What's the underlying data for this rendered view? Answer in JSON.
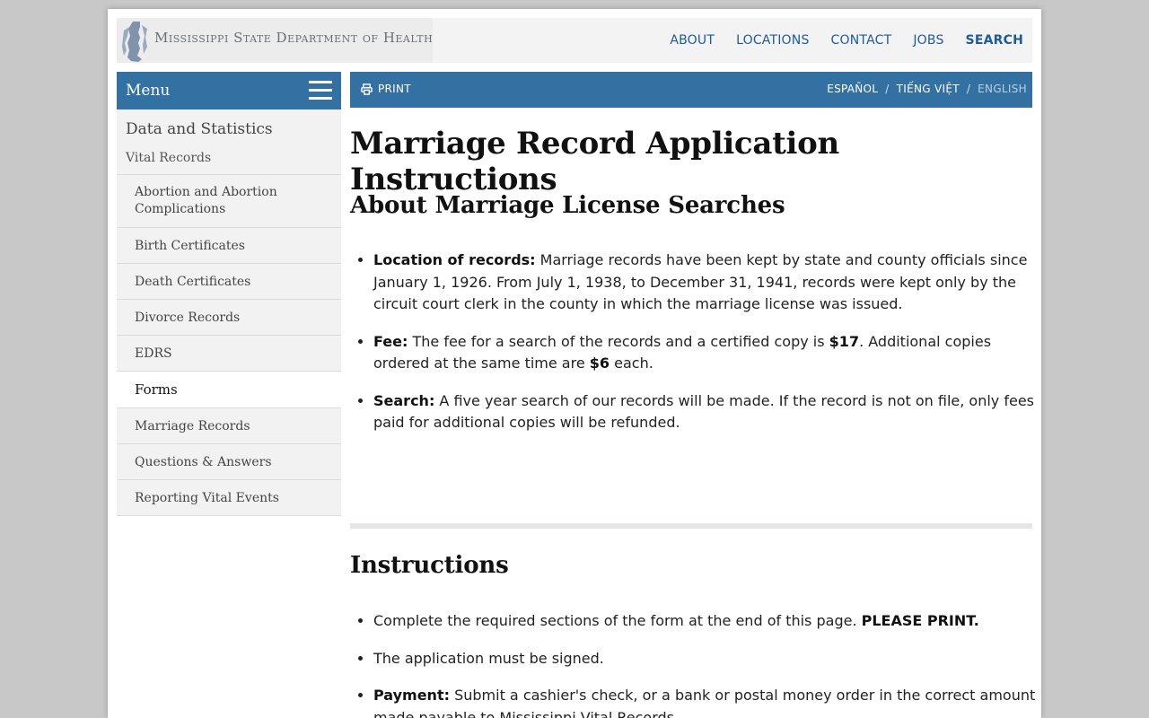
{
  "header": {
    "logo_text": "Mississippi State Department of Health",
    "nav": [
      {
        "label": "ABOUT"
      },
      {
        "label": "LOCATIONS"
      },
      {
        "label": "CONTACT"
      },
      {
        "label": "JOBS"
      },
      {
        "label": "SEARCH"
      }
    ]
  },
  "sidebar": {
    "menu_label": "Menu",
    "section_title": "Data and Statistics",
    "subsection": "Vital Records",
    "items": [
      {
        "label": "Abortion and Abortion Complications"
      },
      {
        "label": "Birth Certificates"
      },
      {
        "label": "Death Certificates"
      },
      {
        "label": "Divorce Records"
      },
      {
        "label": "EDRS"
      },
      {
        "label": "Forms"
      },
      {
        "label": "Marriage Records"
      },
      {
        "label": "Questions & Answers"
      },
      {
        "label": "Reporting Vital Events"
      }
    ]
  },
  "utility": {
    "print_label": "PRINT",
    "languages": [
      "ESPAÑOL",
      "TIẾNG VIỆT",
      "ENGLISH"
    ],
    "separator": "/"
  },
  "main": {
    "title": "Marriage Record Application Instructions",
    "about_heading": "About Marriage License Searches",
    "about_items": [
      {
        "label": "Location of records:",
        "text": " Marriage records have been kept by state and county officials since January 1, 1926. From July 1, 1938, to December 31, 1941, records were kept only by the circuit court clerk in the county in which the marriage license was issued."
      },
      {
        "label": "Fee:",
        "text_a": " The fee for a search of the records and a certified copy is ",
        "price_a": "$17",
        "text_b": ". Additional copies ordered at the same time are ",
        "price_b": "$6",
        "text_c": " each."
      },
      {
        "label": "Search:",
        "text": " A five year search of our records will be made. If the record is not on file, only fees paid for additional copies will be refunded."
      }
    ],
    "instructions_heading": "Instructions",
    "instruction_items": [
      {
        "text": "Complete the required sections of the form at the end of this page. ",
        "emph": "PLEASE PRINT."
      },
      {
        "text": "The application must be signed."
      },
      {
        "label": "Payment:",
        "text": " Submit a cashier's check, or a bank or postal money order in the correct amount made payable to Mississippi Vital Records."
      }
    ]
  },
  "colors": {
    "brand_blue": "#3471a3",
    "link_blue": "#1f5b9a"
  }
}
